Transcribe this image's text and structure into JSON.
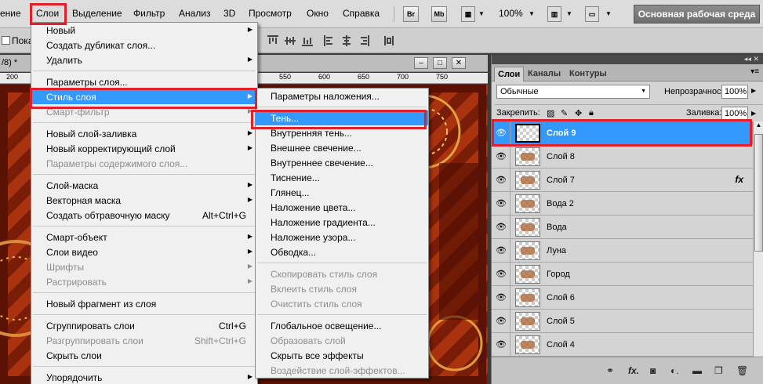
{
  "menubar": {
    "items": [
      "ение",
      "Слои",
      "Выделение",
      "Фильтр",
      "Анализ",
      "3D",
      "Просмотр",
      "Окно",
      "Справка"
    ],
    "br_label": "Br",
    "mb_label": "Mb",
    "zoom": "100%",
    "workspace_label": "Основная рабочая среда"
  },
  "optbar": {
    "checkbox_label": "Показ"
  },
  "document": {
    "title": "/8) *",
    "ruler_ticks": [
      "200",
      "550",
      "600",
      "650",
      "700",
      "750"
    ]
  },
  "layer_menu": {
    "items": [
      {
        "label": "Новый",
        "submenu": true
      },
      {
        "label": "Создать дубликат слоя...",
        "submenu": false
      },
      {
        "label": "Удалить",
        "submenu": true
      },
      {
        "sep": true
      },
      {
        "label": "Параметры слоя...",
        "submenu": false
      },
      {
        "label": "Стиль слоя",
        "submenu": true,
        "highlight": true
      },
      {
        "label": "Смарт-фильтр",
        "submenu": true,
        "disabled": true
      },
      {
        "sep": true
      },
      {
        "label": "Новый слой-заливка",
        "submenu": true
      },
      {
        "label": "Новый корректирующий слой",
        "submenu": true
      },
      {
        "label": "Параметры содержимого слоя...",
        "disabled": true
      },
      {
        "sep": true
      },
      {
        "label": "Слой-маска",
        "submenu": true
      },
      {
        "label": "Векторная маска",
        "submenu": true
      },
      {
        "label": "Создать обтравочную маску",
        "shortcut": "Alt+Ctrl+G"
      },
      {
        "sep": true
      },
      {
        "label": "Смарт-объект",
        "submenu": true
      },
      {
        "label": "Слои видео",
        "submenu": true
      },
      {
        "label": "Шрифты",
        "submenu": true,
        "disabled": true
      },
      {
        "label": "Растрировать",
        "submenu": true,
        "disabled": true
      },
      {
        "sep": true
      },
      {
        "label": "Новый фрагмент из слоя"
      },
      {
        "sep": true
      },
      {
        "label": "Сгруппировать слои",
        "shortcut": "Ctrl+G"
      },
      {
        "label": "Разгруппировать слои",
        "shortcut": "Shift+Ctrl+G",
        "disabled": true
      },
      {
        "label": "Скрыть слои"
      },
      {
        "sep": true
      },
      {
        "label": "Упорядочить",
        "submenu": true
      }
    ]
  },
  "style_menu": {
    "items": [
      {
        "label": "Параметры наложения..."
      },
      {
        "sep": true
      },
      {
        "label": "Тень...",
        "highlight": true
      },
      {
        "label": "Внутренняя тень..."
      },
      {
        "label": "Внешнее свечение..."
      },
      {
        "label": "Внутреннее свечение..."
      },
      {
        "label": "Тиснение..."
      },
      {
        "label": "Глянец..."
      },
      {
        "label": "Наложение цвета..."
      },
      {
        "label": "Наложение градиента..."
      },
      {
        "label": "Наложение узора..."
      },
      {
        "label": "Обводка..."
      },
      {
        "sep": true
      },
      {
        "label": "Скопировать стиль слоя",
        "disabled": true
      },
      {
        "label": "Вклеить стиль слоя",
        "disabled": true
      },
      {
        "label": "Очистить стиль слоя",
        "disabled": true
      },
      {
        "sep": true
      },
      {
        "label": "Глобальное освещение..."
      },
      {
        "label": "Образовать слой",
        "disabled": true
      },
      {
        "label": "Скрыть все эффекты"
      },
      {
        "label": "Воздействие слой-эффектов...",
        "disabled": true
      }
    ]
  },
  "layers_panel": {
    "tabs": [
      "Слои",
      "Каналы",
      "Контуры"
    ],
    "blend_mode": "Обычные",
    "opacity_label": "Непрозрачность:",
    "opacity_value": "100%",
    "lock_label": "Закрепить:",
    "fill_label": "Заливка:",
    "fill_value": "100%",
    "layers": [
      {
        "name": "Слой 9",
        "selected": true
      },
      {
        "name": "Слой 8"
      },
      {
        "name": "Слой 7",
        "fx": true
      },
      {
        "name": "Вода 2"
      },
      {
        "name": "Вода"
      },
      {
        "name": "Луна"
      },
      {
        "name": "Город"
      },
      {
        "name": "Слой 6"
      },
      {
        "name": "Слой 5"
      },
      {
        "name": "Слой 4"
      }
    ],
    "fx_symbol": "fx"
  },
  "colors": {
    "highlight": "#3399ff",
    "annotation_red": "#e0202a",
    "workspace_button": "#7a7a7a"
  }
}
